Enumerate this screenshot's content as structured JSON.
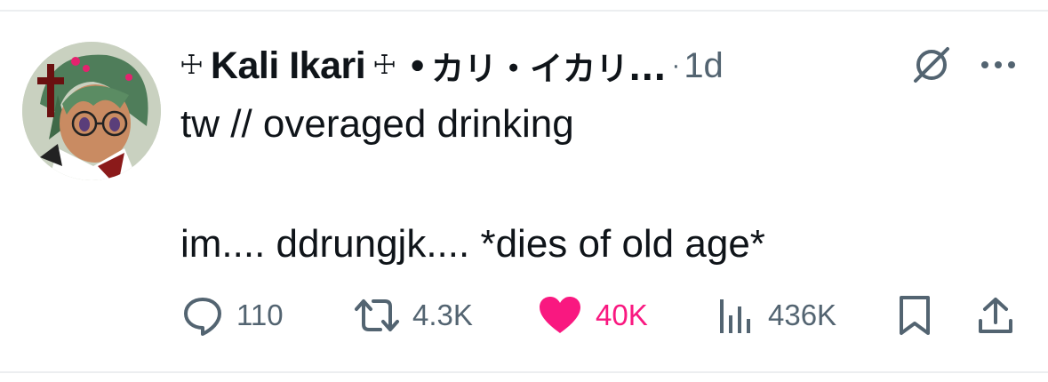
{
  "tweet": {
    "author": {
      "cross_left": "☩",
      "name": "Kali Ikari",
      "cross_right": "☩",
      "separator": "•",
      "name_jp": "カリ・イカリ...",
      "avatar_icon": "anime-avatar-icon"
    },
    "time_separator": "·",
    "time": "1d",
    "text_line1": "tw // overaged drinking",
    "text_line2": "im.... ddrungjk.... *dies of old age*",
    "metrics": {
      "replies": "110",
      "retweets": "4.3K",
      "likes": "40K",
      "views": "436K"
    }
  },
  "colors": {
    "text": "#0f1419",
    "muted": "#536471",
    "like": "#f91880"
  }
}
